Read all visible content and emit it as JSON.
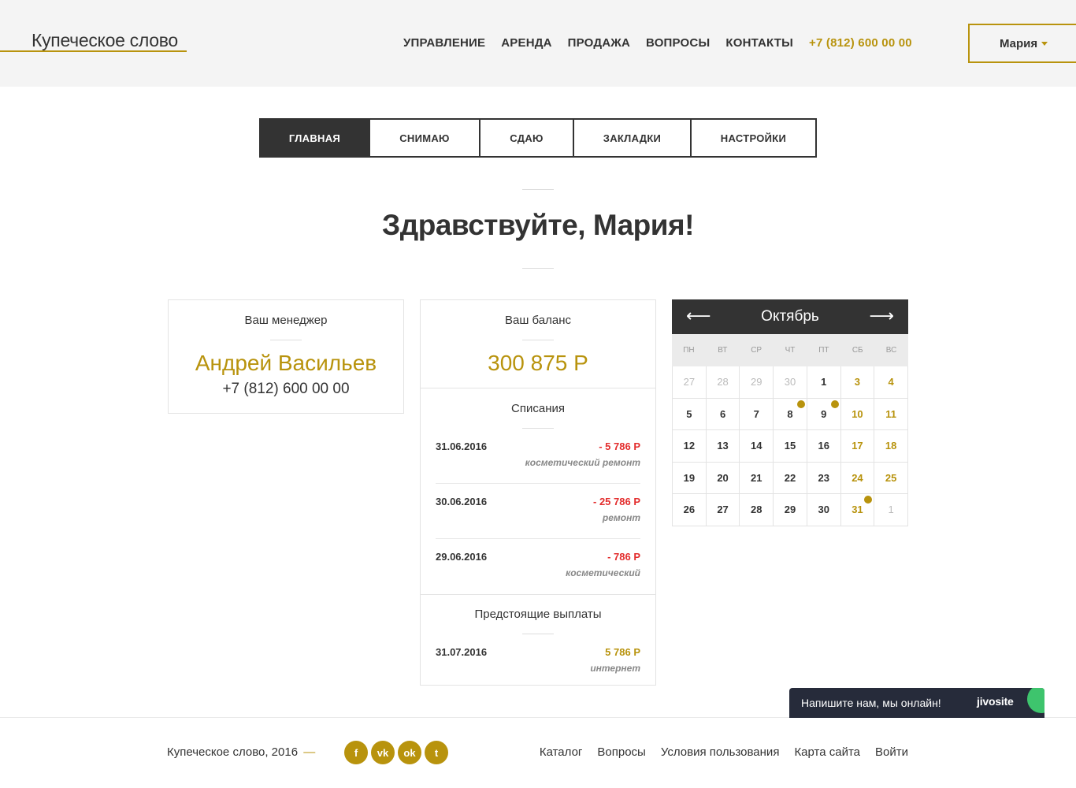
{
  "header": {
    "logo": "Купеческое слово",
    "nav": [
      "УПРАВЛЕНИЕ",
      "АРЕНДА",
      "ПРОДАЖА",
      "ВОПРОСЫ",
      "КОНТАКТЫ"
    ],
    "phone": "+7 (812) 600 00 00",
    "user": "Мария"
  },
  "tabs": [
    {
      "label": "ГЛАВНАЯ",
      "active": true
    },
    {
      "label": "СНИМАЮ",
      "active": false
    },
    {
      "label": "СДАЮ",
      "active": false
    },
    {
      "label": "ЗАКЛАДКИ",
      "active": false
    },
    {
      "label": "НАСТРОЙКИ",
      "active": false
    }
  ],
  "greeting": "Здравствуйте, Мария!",
  "manager": {
    "title": "Ваш менеджер",
    "name": "Андрей Васильев",
    "phone": "+7 (812) 600 00 00"
  },
  "balance": {
    "title": "Ваш баланс",
    "amount": "300 875 Р",
    "charges_title": "Списания",
    "charges": [
      {
        "date": "31.06.2016",
        "amount": "- 5 786 Р",
        "note": "косметический ремонт"
      },
      {
        "date": "30.06.2016",
        "amount": "- 25 786 Р",
        "note": "ремонт"
      },
      {
        "date": "29.06.2016",
        "amount": "- 786 Р",
        "note": "косметический"
      }
    ],
    "upcoming_title": "Предстоящие выплаты",
    "upcoming": [
      {
        "date": "31.07.2016",
        "amount": "5 786 Р",
        "note": "интернет"
      }
    ]
  },
  "calendar": {
    "month": "Октябрь",
    "prev_icon": "arrow-left-icon",
    "next_icon": "arrow-right-icon",
    "weekdays": [
      "ПН",
      "ВТ",
      "СР",
      "ЧТ",
      "ПТ",
      "СБ",
      "ВС"
    ],
    "weeks": [
      [
        {
          "d": "27",
          "m": true
        },
        {
          "d": "28",
          "m": true
        },
        {
          "d": "29",
          "m": true
        },
        {
          "d": "30",
          "m": true
        },
        {
          "d": "1"
        },
        {
          "d": "3",
          "w": true
        },
        {
          "d": "4",
          "w": true
        }
      ],
      [
        {
          "d": "5"
        },
        {
          "d": "6"
        },
        {
          "d": "7"
        },
        {
          "d": "8",
          "dot": true
        },
        {
          "d": "9",
          "dot": true
        },
        {
          "d": "10",
          "w": true
        },
        {
          "d": "11",
          "w": true
        }
      ],
      [
        {
          "d": "12"
        },
        {
          "d": "13"
        },
        {
          "d": "14"
        },
        {
          "d": "15"
        },
        {
          "d": "16"
        },
        {
          "d": "17",
          "w": true
        },
        {
          "d": "18",
          "w": true
        }
      ],
      [
        {
          "d": "19"
        },
        {
          "d": "20"
        },
        {
          "d": "21"
        },
        {
          "d": "22"
        },
        {
          "d": "23"
        },
        {
          "d": "24",
          "w": true
        },
        {
          "d": "25",
          "w": true
        }
      ],
      [
        {
          "d": "26"
        },
        {
          "d": "27"
        },
        {
          "d": "28"
        },
        {
          "d": "29"
        },
        {
          "d": "30"
        },
        {
          "d": "31",
          "w": true,
          "dot": true
        },
        {
          "d": "1",
          "m": true
        }
      ]
    ]
  },
  "footer": {
    "copyright": "Купеческое слово, 2016",
    "dash": "—",
    "socials": [
      {
        "icon": "facebook-icon",
        "glyph": "f"
      },
      {
        "icon": "vk-icon",
        "glyph": "vk"
      },
      {
        "icon": "odnoklassniki-icon",
        "glyph": "ok"
      },
      {
        "icon": "twitter-icon",
        "glyph": "t"
      }
    ],
    "links": [
      "Каталог",
      "Вопросы",
      "Условия пользования",
      "Карта сайта",
      "Войти"
    ]
  },
  "chat": {
    "message": "Напишите нам, мы онлайн!",
    "brand": "jivosite"
  },
  "colors": {
    "accent": "#b8930d",
    "dark": "#333333",
    "negative": "#e32d2d",
    "chat_bg": "#262b3a"
  }
}
